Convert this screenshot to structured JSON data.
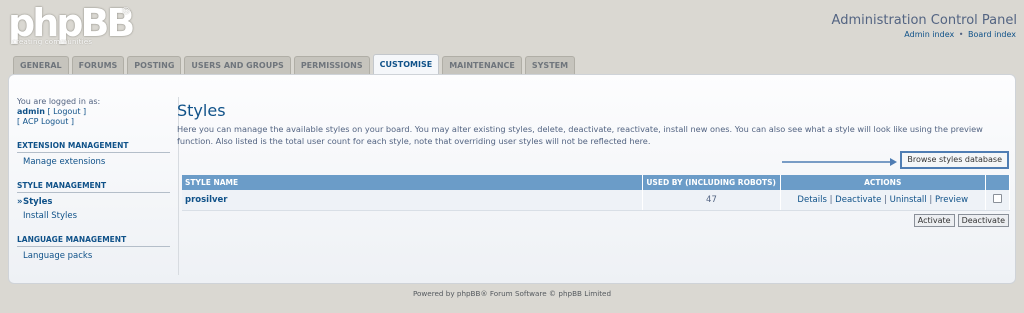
{
  "logo": {
    "wordmark": "phpBB",
    "registered": "®",
    "tagline": "creating communities"
  },
  "header": {
    "title": "Administration Control Panel",
    "links": [
      "Admin index",
      "Board index"
    ],
    "separator": "•"
  },
  "tabs": [
    {
      "label": "GENERAL"
    },
    {
      "label": "FORUMS"
    },
    {
      "label": "POSTING"
    },
    {
      "label": "USERS AND GROUPS"
    },
    {
      "label": "PERMISSIONS"
    },
    {
      "label": "CUSTOMISE",
      "active": true
    },
    {
      "label": "MAINTENANCE"
    },
    {
      "label": "SYSTEM"
    }
  ],
  "sidebar": {
    "logged_in_label": "You are logged in as:",
    "username": "admin",
    "logout_link": "[ Logout ]",
    "acp_logout_link": "[ ACP Logout ]",
    "sections": [
      {
        "heading": "EXTENSION MANAGEMENT",
        "items": [
          "Manage extensions"
        ]
      },
      {
        "heading": "STYLE MANAGEMENT",
        "items": [
          "Styles",
          "Install Styles"
        ]
      },
      {
        "heading": "LANGUAGE MANAGEMENT",
        "items": [
          "Language packs"
        ]
      }
    ]
  },
  "main": {
    "title": "Styles",
    "description": "Here you can manage the available styles on your board. You may alter existing styles, delete, deactivate, reactivate, install new ones. You can also see what a style will look like using the preview function. Also listed is the total user count for each style, note that overriding user styles will not be reflected here.",
    "browse_button": "Browse styles database",
    "table": {
      "headers": [
        "STYLE NAME",
        "USED BY (INCLUDING ROBOTS)",
        "ACTIONS"
      ],
      "rows": [
        {
          "name": "prosilver",
          "used_by": "47",
          "actions": [
            "Details",
            "Deactivate",
            "Uninstall",
            "Preview"
          ]
        }
      ]
    },
    "activate_button": "Activate",
    "deactivate_button": "Deactivate"
  },
  "footer": {
    "text": "Powered by phpBB® Forum Software © phpBB Limited"
  },
  "colors": {
    "accent": "#105289",
    "table_header": "#6b9cc8",
    "background": "#dad8d2"
  }
}
